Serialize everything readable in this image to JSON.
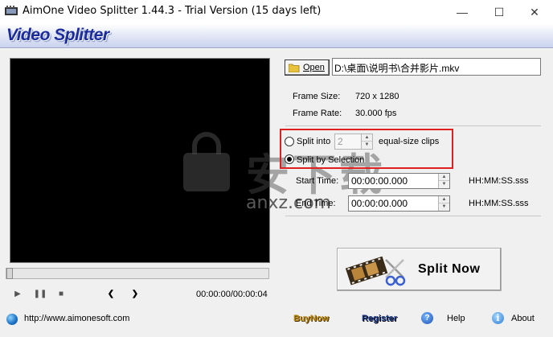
{
  "window": {
    "title": "AimOne Video Splitter 1.44.3 - Trial Version (15 days left)",
    "minimize_glyph": "—",
    "maximize_glyph": "☐",
    "close_glyph": "✕"
  },
  "banner": {
    "title": "Video Splitter"
  },
  "player": {
    "time_readout": "00:00:00/00:00:04",
    "progress": 0,
    "controls": {
      "play": "▶",
      "pause": "❚❚",
      "stop": "■",
      "prev": "❮",
      "next": "❯"
    }
  },
  "file": {
    "open_label": "Open",
    "path": "D:\\桌面\\说明书\\合并影片.mkv"
  },
  "info": {
    "frame_size_label": "Frame Size:",
    "frame_size_value": "720 x 1280",
    "frame_rate_label": "Frame Rate:",
    "frame_rate_value": "30.000 fps"
  },
  "split": {
    "into_label": "Split into",
    "into_value": "2",
    "clips_label": "equal-size clips",
    "selection_label": "Split by Selection",
    "selected_mode": "selection",
    "start_label": "Start Time:",
    "start_value": "00:00:00.000",
    "end_label": "End Time:",
    "end_value": "00:00:00.000",
    "time_format": "HH:MM:SS.sss",
    "button_label": "Split Now"
  },
  "footer": {
    "url": "http://www.aimonesoft.com",
    "buynow": "BuyNow",
    "register": "Register",
    "help": "Help",
    "about": "About"
  },
  "watermark": {
    "text": "anxz.com",
    "chars": "安下载"
  },
  "colors": {
    "highlight": "#e0201e",
    "banner_text": "#1c2c9c"
  }
}
